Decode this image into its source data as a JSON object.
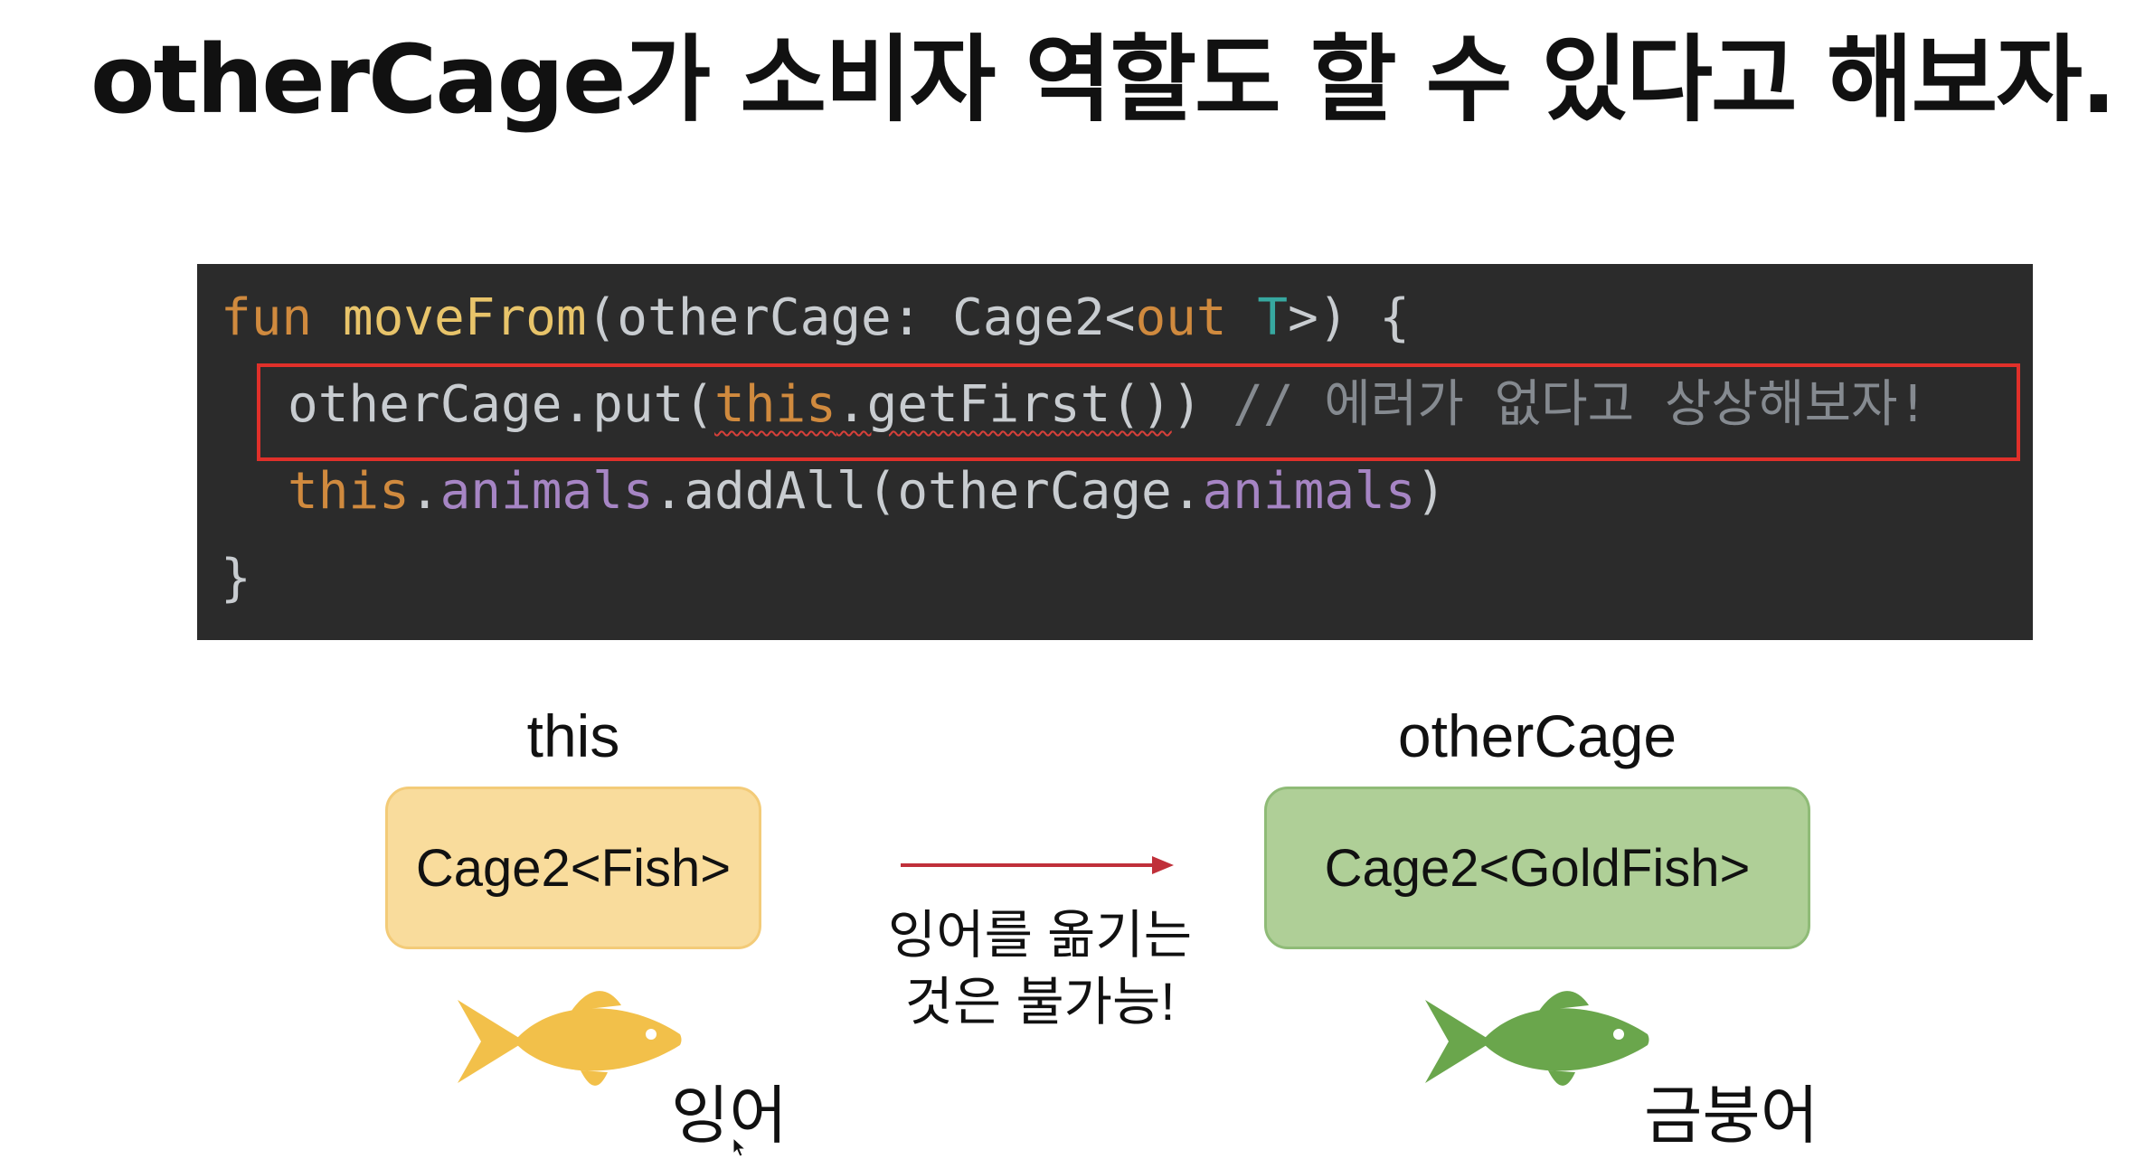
{
  "slide": {
    "title": "otherCage가 소비자 역할도 할 수 있다고 해보자."
  },
  "code": {
    "line1": {
      "kw_fun": "fun",
      "fn_name": "moveFrom",
      "params_open": "(otherCage: Cage2<",
      "kw_out": "out",
      "type_param": "T",
      "close": ">) {"
    },
    "line2": {
      "receiver": "otherCage.put(",
      "error_expr_this": "this",
      "error_expr_call": ".getFirst()",
      "close": ")",
      "comment": "// 에러가 없다고 상상해보자!"
    },
    "line3": {
      "kw_this": "this",
      "dot1": ".",
      "prop1": "animals",
      "call": ".addAll(otherCage.",
      "prop2": "animals",
      "close": ")"
    },
    "line4": "}"
  },
  "diagram": {
    "left_label": "this",
    "left_box": "Cage2<Fish>",
    "right_label": "otherCage",
    "right_box": "Cage2<GoldFish>",
    "note_line1": "잉어를 옮기는",
    "note_line2": "것은 불가능!",
    "left_fish_name": "잉어",
    "right_fish_name": "금붕어",
    "colors": {
      "left_box": "#f9dc9c",
      "right_box": "#afcf97",
      "arrow": "#c0303a",
      "left_fish": "#f2c04a",
      "right_fish": "#6aa64c",
      "highlight": "#e0302a"
    },
    "icons": [
      "carp-fish-icon",
      "goldfish-icon",
      "arrow-right-icon",
      "mouse-cursor-icon"
    ]
  }
}
